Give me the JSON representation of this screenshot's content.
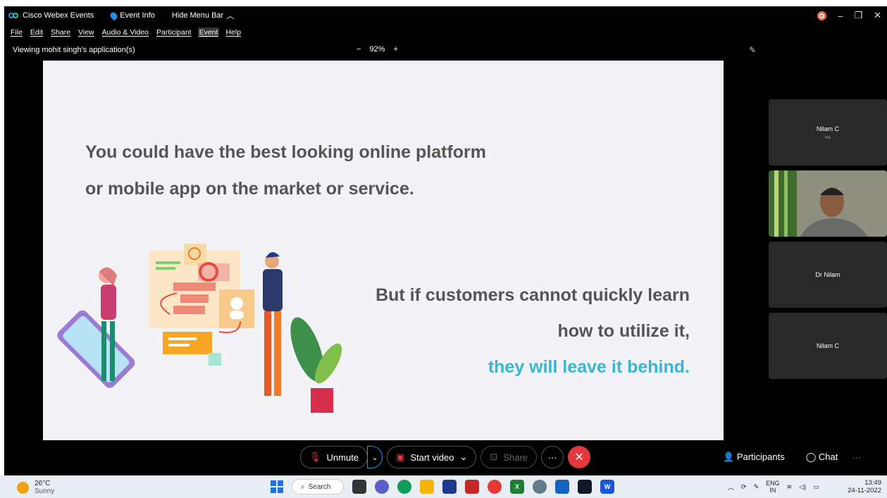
{
  "titlebar": {
    "app_name": "Cisco Webex Events",
    "event_info": "Event Info",
    "hide_menu": "Hide Menu Bar",
    "min": "–",
    "restore": "❐",
    "close": "✕"
  },
  "menu": [
    "File",
    "Edit",
    "Share",
    "View",
    "Audio & Video",
    "Participant",
    "Event",
    "Help"
  ],
  "viewbar": {
    "viewing": "Viewing mohit singh's application(s)",
    "zoom_minus": "−",
    "zoom": "92%",
    "zoom_plus": "+"
  },
  "slide": {
    "line1": "You could have the best looking online platform",
    "line2": "or mobile app on the market or service.",
    "line3": "But if customers cannot quickly learn",
    "line4": "how to utilize it,",
    "line5": "they will leave it behind."
  },
  "tiles": [
    {
      "name": "Nilam C",
      "sub": "Me"
    },
    {
      "name": "",
      "sub": ""
    },
    {
      "name": "Dr Nilam",
      "sub": ""
    },
    {
      "name": "Nilam C",
      "sub": ""
    }
  ],
  "controls": {
    "unmute": "Unmute",
    "start_video": "Start video",
    "share": "Share",
    "more": "···",
    "participants": "Participants",
    "chat": "Chat",
    "overflow": "···"
  },
  "taskbar": {
    "temp": "26°C",
    "condition": "Sunny",
    "search": "Search",
    "lang1": "ENG",
    "lang2": "IN",
    "time": "13:49",
    "date": "24-11-2022"
  },
  "colors": {
    "accent": "#1e9ce8",
    "end_call": "#e4393c",
    "slide_highlight": "#36b7cf",
    "slide_text": "#555555"
  }
}
